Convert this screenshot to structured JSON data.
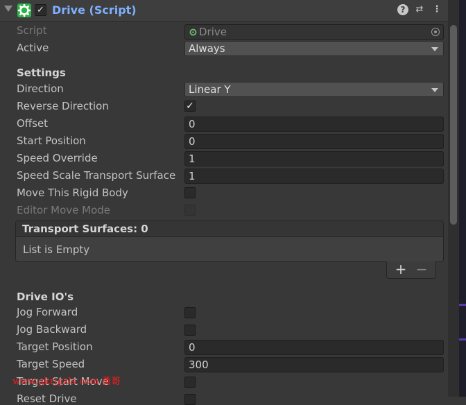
{
  "header": {
    "title": "Drive (Script)",
    "enabled_check": "✓",
    "help_glyph": "?",
    "preset_glyph": "⇄",
    "menu_glyph": "⋮"
  },
  "script": {
    "label": "Script",
    "value": "Drive"
  },
  "active": {
    "label": "Active",
    "value": "Always"
  },
  "settings": {
    "heading": "Settings",
    "direction": {
      "label": "Direction",
      "value": "Linear Y"
    },
    "reverse_direction": {
      "label": "Reverse Direction",
      "checked": true,
      "mark": "✓"
    },
    "offset": {
      "label": "Offset",
      "value": "0"
    },
    "start_position": {
      "label": "Start Position",
      "value": "0"
    },
    "speed_override": {
      "label": "Speed Override",
      "value": "1"
    },
    "speed_scale": {
      "label": "Speed Scale Transport Surface",
      "value": "1"
    },
    "move_rigid_body": {
      "label": "Move This Rigid Body",
      "checked": false
    },
    "editor_move_mode": {
      "label": "Editor Move Mode",
      "checked": false,
      "disabled": true
    }
  },
  "transport_surfaces": {
    "header": "Transport Surfaces: 0",
    "empty_text": "List is Empty",
    "add_label": "+",
    "remove_label": "−"
  },
  "drive_io": {
    "heading": "Drive IO's",
    "jog_forward": {
      "label": "Jog Forward",
      "checked": false
    },
    "jog_backward": {
      "label": "Jog Backward",
      "checked": false
    },
    "target_position": {
      "label": "Target Position",
      "value": "0"
    },
    "target_speed": {
      "label": "Target Speed",
      "value": "300"
    },
    "target_start_move": {
      "label": "Target Start Move",
      "checked": false
    },
    "reset_drive": {
      "label": "Reset Drive",
      "checked": false
    }
  },
  "watermark": "www.gkrjgzls.com 勇哥",
  "colors": {
    "title": "#7fb0ff",
    "background": "#383838",
    "field": "#2a2a2a",
    "gear": "#2fb24a",
    "watermark": "#ff1a1a"
  }
}
